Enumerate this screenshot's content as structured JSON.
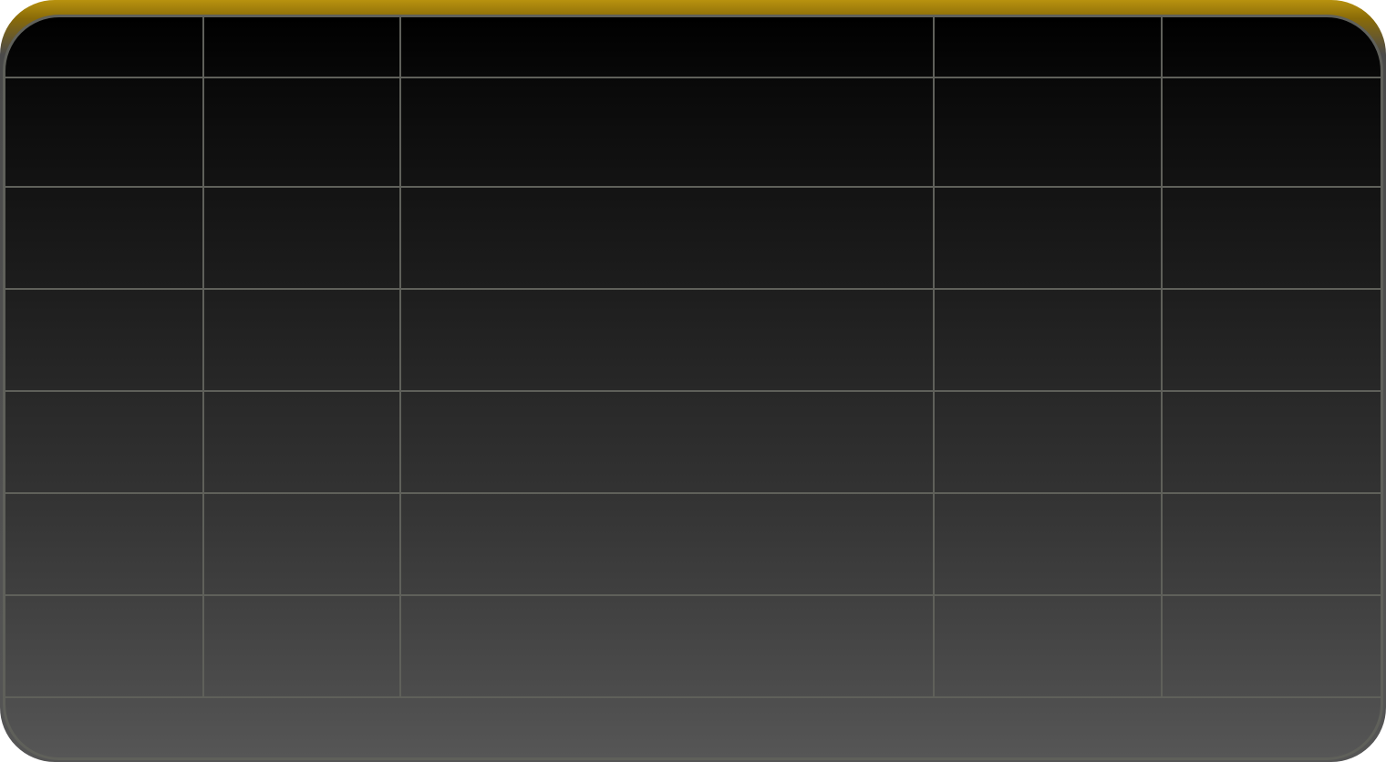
{
  "table": {
    "header": [
      "",
      "",
      "",
      "",
      ""
    ],
    "rows": [
      [
        "",
        "",
        "",
        "",
        ""
      ],
      [
        "",
        "",
        "",
        "",
        ""
      ],
      [
        "",
        "",
        "",
        "",
        ""
      ],
      [
        "",
        "",
        "",
        "",
        ""
      ],
      [
        "",
        "",
        "",
        "",
        ""
      ],
      [
        "",
        "",
        "",
        "",
        ""
      ]
    ]
  },
  "colors": {
    "accent_top": "#b8920f",
    "grid_line": "#5f605a",
    "panel_top": "#000000",
    "panel_bottom": "#565656"
  }
}
